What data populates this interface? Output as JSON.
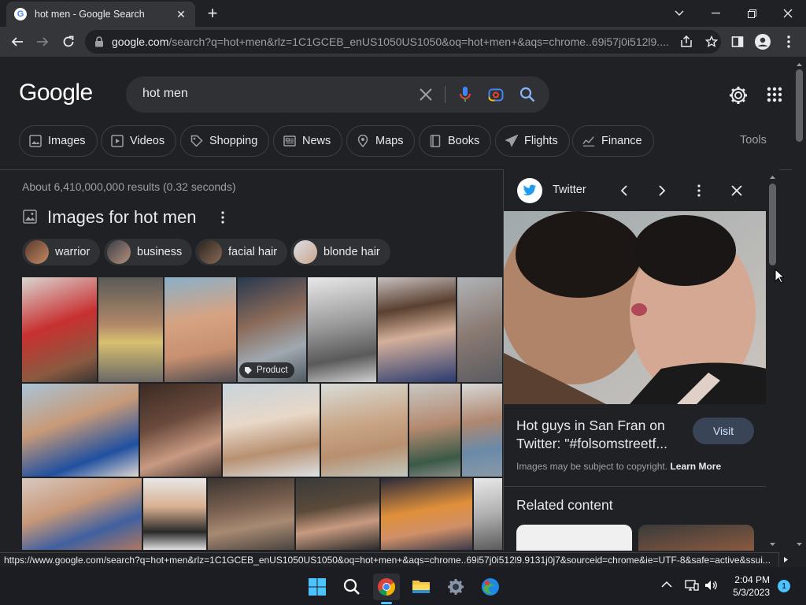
{
  "browser": {
    "tab_title": "hot men - Google Search",
    "new_tab": "+",
    "url_domain": "google.com",
    "url_rest": "/search?q=hot+men&rlz=1C1GCEB_enUS1050US1050&oq=hot+men+&aqs=chrome..69i57j0i512l9...."
  },
  "google": {
    "logo": "Google",
    "query": "hot men",
    "chips": [
      "Images",
      "Videos",
      "Shopping",
      "News",
      "Maps",
      "Books",
      "Flights",
      "Finance"
    ],
    "tools": "Tools",
    "results_stats": "About 6,410,000,000 results (0.32 seconds)",
    "images_heading": "Images for hot men",
    "refine_chips": [
      "warrior",
      "business",
      "facial hair",
      "blonde hair"
    ],
    "product_badge": "Product"
  },
  "panel": {
    "source_name": "Twitter",
    "title": "Hot guys in San Fran on Twitter: \"#folsomstreetf...",
    "visit": "Visit",
    "copyright": "Images may be subject to copyright.",
    "learn_more": "Learn More",
    "related": "Related content"
  },
  "status_url": "https://www.google.com/search?q=hot+men&rlz=1C1GCEB_enUS1050US1050&oq=hot+men+&aqs=chrome..69i57j0i512l9.9131j0j7&sourceid=chrome&ie=UTF-8&safe=active&ssui...",
  "taskbar": {
    "time": "2:04 PM",
    "date": "5/3/2023",
    "notifications": "1"
  },
  "colors": {
    "bg": "#202124",
    "chip_border": "#3c4043",
    "accent": "#8ab4f8"
  }
}
